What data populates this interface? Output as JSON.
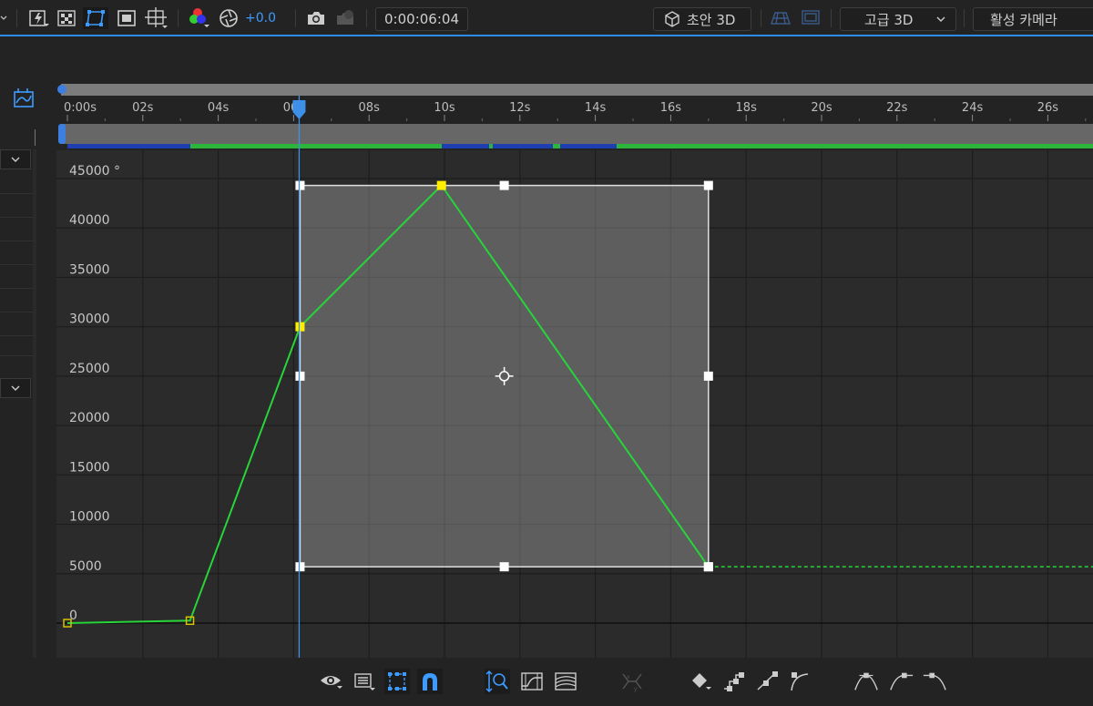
{
  "toolbar": {
    "color_offset": "+0.0",
    "timecode": "0:00:06:04",
    "draft_3d_label": "초안 3D",
    "renderer_label": "고급 3D",
    "camera_label": "활성 카메라"
  },
  "timeline": {
    "ruler_labels": [
      "0:00s",
      "02s",
      "04s",
      "06s",
      "08s",
      "10s",
      "12s",
      "14s",
      "16s",
      "18s",
      "20s",
      "22s",
      "24s",
      "26s"
    ],
    "current_time_seconds": 6.17
  },
  "graph": {
    "y_labels": [
      "45000 °",
      "40000",
      "35000",
      "30000",
      "25000",
      "20000",
      "15000",
      "10000",
      "5000",
      "0"
    ],
    "keyframes": [
      {
        "t": 0.0,
        "v": 0
      },
      {
        "t": 3.25,
        "v": 250
      },
      {
        "t": 6.17,
        "v": 30000
      },
      {
        "t": 9.92,
        "v": 44300
      },
      {
        "t": 17.0,
        "v": 5700
      }
    ],
    "hold_value": 5700,
    "selected_keyframes": [
      2,
      3,
      4
    ]
  },
  "colors": {
    "accent": "#2d8ceb",
    "curve": "#27d43a",
    "keyframe_selected": "#ffee00",
    "keyframe_unselected": "#d8c200"
  }
}
